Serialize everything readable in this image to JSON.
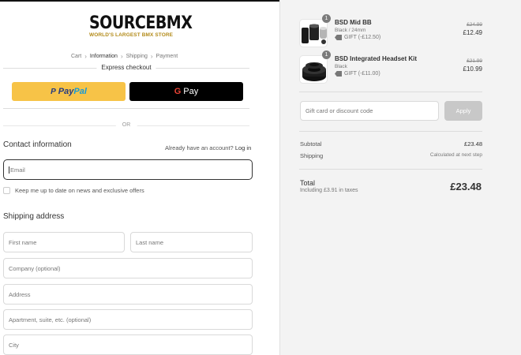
{
  "brand": {
    "name": "SOURCEBMX",
    "tagline": "WORLD'S LARGEST BMX STORE"
  },
  "breadcrumb": {
    "items": [
      "Cart",
      "Information",
      "Shipping",
      "Payment"
    ],
    "current": "Information"
  },
  "express_checkout": {
    "label": "Express checkout",
    "paypal_pay": "Pay",
    "paypal_pal": "Pal",
    "gpay_g": "G",
    "gpay_text": "Pay"
  },
  "divider_or": "OR",
  "contact": {
    "title": "Contact information",
    "login_prompt": "Already have an account?",
    "login_link": "Log in",
    "email_placeholder": "Email",
    "newsletter_label": "Keep me up to date on news and exclusive offers"
  },
  "shipping": {
    "title": "Shipping address",
    "first_name": "First name",
    "last_name": "Last name",
    "company": "Company (optional)",
    "address": "Address",
    "apartment": "Apartment, suite, etc. (optional)",
    "city": "City"
  },
  "cart": {
    "items": [
      {
        "name": "BSD Mid BB",
        "variant": "Black / 24mm",
        "gift": "GIFT (-£12.50)",
        "old_price": "£24.99",
        "price": "£12.49",
        "quantity": "1"
      },
      {
        "name": "BSD Integrated Headset Kit",
        "variant": "Black",
        "gift": "GIFT (-£11.00)",
        "old_price": "£21.99",
        "price": "£10.99",
        "quantity": "1"
      }
    ]
  },
  "discount": {
    "placeholder": "Gift card or discount code",
    "apply_label": "Apply"
  },
  "summary": {
    "subtotal_label": "Subtotal",
    "subtotal_value": "£23.48",
    "shipping_label": "Shipping",
    "shipping_value": "Calculated at next step",
    "total_label": "Total",
    "taxes_note": "Including £3.91 in taxes",
    "total_value": "£23.48"
  },
  "colors": {
    "paypal_yellow": "#f7c347",
    "gpay_black": "#000000",
    "brand_gold": "#b38b1a",
    "sidebar_bg": "#f3f3f3",
    "apply_disabled": "#c8c8c8"
  }
}
